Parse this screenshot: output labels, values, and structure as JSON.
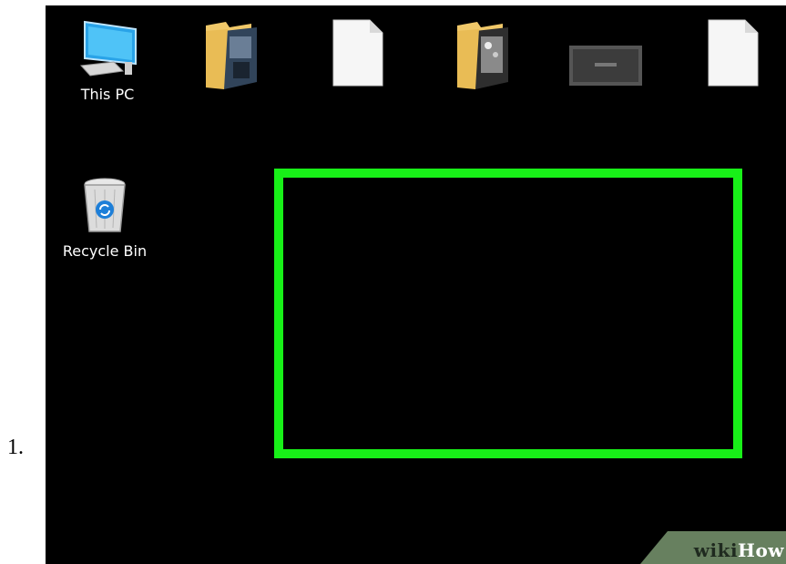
{
  "step": {
    "number": "1."
  },
  "desktop": {
    "icons": {
      "this_pc": {
        "label": "This PC",
        "icon": "monitor-icon"
      },
      "recycle_bin": {
        "label": "Recycle Bin",
        "icon": "recycle-bin-icon"
      }
    },
    "top_items": [
      {
        "icon": "photo-folder-icon"
      },
      {
        "icon": "document-icon"
      },
      {
        "icon": "photo-folder-icon"
      },
      {
        "icon": "image-thumbnail-icon"
      },
      {
        "icon": "document-icon"
      }
    ]
  },
  "highlight": {
    "color": "#18f018"
  },
  "watermark": {
    "part1": "wiki",
    "part2": "How"
  }
}
